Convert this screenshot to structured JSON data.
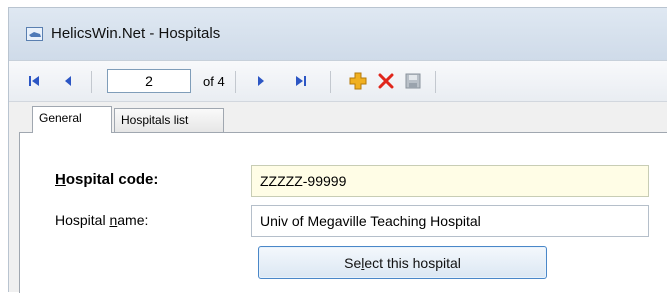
{
  "window": {
    "title": "HelicsWin.Net - Hospitals"
  },
  "toolbar": {
    "position_value": "2",
    "of_label": "of 4",
    "icons": [
      "first-record-icon",
      "previous-record-icon",
      "next-record-icon",
      "last-record-icon",
      "add-icon",
      "delete-icon",
      "save-icon"
    ],
    "colors": {
      "nav": "#2c56c4",
      "add": "#f0b020",
      "delete": "#e0261b",
      "save_disabled": "#9aa3ad"
    }
  },
  "tabs": [
    {
      "label": "General",
      "active": true
    },
    {
      "label": "Hospitals list",
      "active": false
    }
  ],
  "form": {
    "code": {
      "label_pre": "",
      "label_u": "H",
      "label_post": "ospital code:",
      "value": "ZZZZZ-99999"
    },
    "name": {
      "label_pre": "Hospital ",
      "label_u": "n",
      "label_post": "ame:",
      "value": "Univ of Megaville Teaching Hospital"
    },
    "select_button": {
      "pre": "Se",
      "u": "l",
      "post": "ect this hospital"
    }
  }
}
